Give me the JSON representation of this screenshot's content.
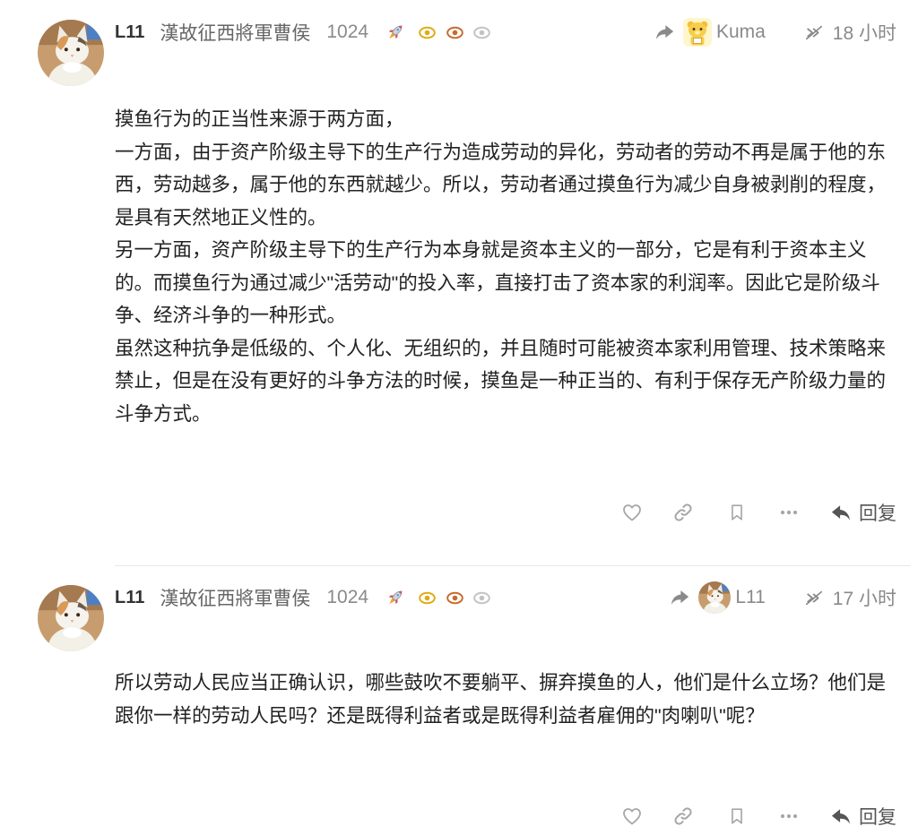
{
  "colors": {
    "text": "#222222",
    "username": "#333333",
    "fullname": "#666666",
    "muted": "#8a8a8a",
    "icon": "#a6a6a6",
    "reply": "#555555",
    "divider": "#e8e8e8",
    "background": "#ffffff"
  },
  "posts": [
    {
      "author": {
        "username": "L11",
        "name": "漢故征西將軍曹侯",
        "score": "1024",
        "avatar": "cat-avatar"
      },
      "badges": [
        {
          "icon": "rocket-icon"
        },
        {
          "icon": "eye-icon",
          "color": "#e0aa12"
        },
        {
          "icon": "eye-icon",
          "color": "#c8692b"
        },
        {
          "icon": "eye-icon",
          "color": "#c2c2c2"
        }
      ],
      "reply_to": {
        "icon": "share-icon",
        "avatar": "kuma-avatar",
        "username": "Kuma"
      },
      "status_icon": "double-chevron-slash-icon",
      "time": "18 小时",
      "paragraphs": [
        "摸鱼行为的正当性来源于两方面，",
        "一方面，由于资产阶级主导下的生产行为造成劳动的异化，劳动者的劳动不再是属于他的东西，劳动越多，属于他的东西就越少。所以，劳动者通过摸鱼行为减少自身被剥削的程度，是具有天然地正义性的。",
        "另一方面，资产阶级主导下的生产行为本身就是资本主义的一部分，它是有利于资本主义的。而摸鱼行为通过减少\"活劳动\"的投入率，直接打击了资本家的利润率。因此它是阶级斗争、经济斗争的一种形式。",
        "虽然这种抗争是低级的、个人化、无组织的，并且随时可能被资本家利用管理、技术策略来禁止，但是在没有更好的斗争方法的时候，摸鱼是一种正当的、有利于保存无产阶级力量的斗争方式。"
      ],
      "actions": {
        "like": {
          "icon": "heart-icon"
        },
        "copy_link": {
          "icon": "link-icon"
        },
        "bookmark": {
          "icon": "bookmark-icon"
        },
        "more": {
          "icon": "ellipsis-icon"
        },
        "reply": {
          "icon": "reply-icon",
          "label": "回复"
        }
      }
    },
    {
      "author": {
        "username": "L11",
        "name": "漢故征西將軍曹侯",
        "score": "1024",
        "avatar": "cat-avatar"
      },
      "badges": [
        {
          "icon": "rocket-icon"
        },
        {
          "icon": "eye-icon",
          "color": "#e0aa12"
        },
        {
          "icon": "eye-icon",
          "color": "#c8692b"
        },
        {
          "icon": "eye-icon",
          "color": "#c2c2c2"
        }
      ],
      "reply_to": {
        "icon": "share-icon",
        "avatar": "cat-avatar",
        "username": "L11"
      },
      "status_icon": "double-chevron-slash-icon",
      "time": "17 小时",
      "paragraphs": [
        "所以劳动人民应当正确认识，哪些鼓吹不要躺平、摒弃摸鱼的人，他们是什么立场？他们是跟你一样的劳动人民吗？还是既得利益者或是既得利益者雇佣的\"肉喇叭\"呢？"
      ],
      "actions": {
        "like": {
          "icon": "heart-icon"
        },
        "copy_link": {
          "icon": "link-icon"
        },
        "bookmark": {
          "icon": "bookmark-icon"
        },
        "more": {
          "icon": "ellipsis-icon"
        },
        "reply": {
          "icon": "reply-icon",
          "label": "回复"
        }
      }
    }
  ]
}
